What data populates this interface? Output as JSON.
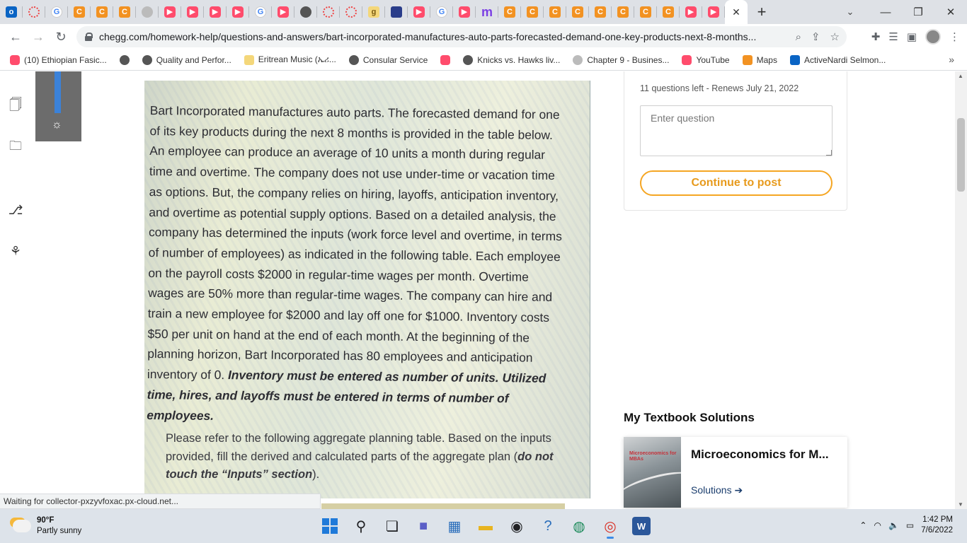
{
  "browser": {
    "url": "chegg.com/homework-help/questions-and-answers/bart-incorporated-manufactures-auto-parts-forecasted-demand-one-key-products-next-8-months...",
    "tabs": [
      {
        "icon": "outlook-icon",
        "letter": "o"
      },
      {
        "icon": "ring-icon",
        "letter": ""
      },
      {
        "icon": "google-icon",
        "letter": "G"
      },
      {
        "icon": "chegg-icon",
        "letter": "C"
      },
      {
        "icon": "chegg-icon",
        "letter": "C"
      },
      {
        "icon": "chegg-icon",
        "letter": "C"
      },
      {
        "icon": "seal-icon",
        "letter": ""
      },
      {
        "icon": "youtube-icon",
        "letter": "▶"
      },
      {
        "icon": "youtube-icon",
        "letter": "▶"
      },
      {
        "icon": "youtube-icon",
        "letter": "▶"
      },
      {
        "icon": "youtube-icon",
        "letter": "▶"
      },
      {
        "icon": "google-icon",
        "letter": "G"
      },
      {
        "icon": "youtube-icon",
        "letter": "▶"
      },
      {
        "icon": "globe-icon",
        "letter": ""
      },
      {
        "icon": "ring-icon",
        "letter": ""
      },
      {
        "icon": "ring-icon",
        "letter": ""
      },
      {
        "icon": "g-icon",
        "letter": "g"
      },
      {
        "icon": "shield-icon",
        "letter": ""
      },
      {
        "icon": "youtube-icon",
        "letter": "▶"
      },
      {
        "icon": "google-icon",
        "letter": "G"
      },
      {
        "icon": "youtube-icon",
        "letter": "▶"
      },
      {
        "icon": "m-icon",
        "letter": "m"
      },
      {
        "icon": "chegg-icon",
        "letter": "C"
      },
      {
        "icon": "chegg-icon",
        "letter": "C"
      },
      {
        "icon": "chegg-icon",
        "letter": "C"
      },
      {
        "icon": "chegg-icon",
        "letter": "C"
      },
      {
        "icon": "chegg-icon",
        "letter": "C"
      },
      {
        "icon": "chegg-icon",
        "letter": "C"
      },
      {
        "icon": "chegg-icon",
        "letter": "C"
      },
      {
        "icon": "chegg-icon",
        "letter": "C"
      },
      {
        "icon": "youtube-icon",
        "letter": "▶"
      },
      {
        "icon": "youtube-icon",
        "letter": "▶"
      }
    ],
    "bookmarks": [
      {
        "label": "(10) Ethiopian Fasic...",
        "icon": "youtube-icon"
      },
      {
        "label": "",
        "icon": "globe-icon"
      },
      {
        "label": "Quality and Perfor...",
        "icon": "globe-icon"
      },
      {
        "label": "Eritrean Music (ኤሪ...",
        "icon": "music-icon"
      },
      {
        "label": "Consular Service",
        "icon": "globe-icon"
      },
      {
        "label": "",
        "icon": "youtube-icon"
      },
      {
        "label": "Knicks vs. Hawks liv...",
        "icon": "globe-icon"
      },
      {
        "label": "Chapter 9 - Busines...",
        "icon": "grid-icon"
      },
      {
        "label": "YouTube",
        "icon": "youtube-icon"
      },
      {
        "label": "Maps",
        "icon": "maps-icon"
      },
      {
        "label": "ActiveNardi Selmon...",
        "icon": "facebook-icon"
      }
    ]
  },
  "question_image": {
    "paragraph1": "Bart Incorporated manufactures auto parts. The forecasted demand for one of its key products during the next 8 months is provided in the table below. An employee can produce an average of 10 units a month during regular time and overtime. The company does not use under-time or vacation time as options. But, the company relies on hiring, layoffs, anticipation inventory, and overtime as potential supply options. Based on a detailed analysis, the company has determined the inputs (work force level and overtime, in terms of number of employees) as indicated in the following table. Each employee on the payroll costs $2000 in regular-time wages per month. Overtime wages are 50% more than regular-time wages. The company can hire and train a new employee for $2000 and lay off one for $1000. Inventory costs $50 per unit on hand at the end of each month. At the beginning of the planning horizon, Bart Incorporated has 80 employees and anticipation inventory of 0.",
    "paragraph1_bold": "Inventory must be entered as number of units. Utilized time, hires, and layoffs must be entered in terms of number of employees.",
    "paragraph2": "Please refer to the following aggregate planning table. Based on the inputs provided, fill the derived and calculated parts of the aggregate plan (",
    "paragraph2_bold": "do not touch the “Inputs” section",
    "paragraph2_end": ")."
  },
  "sidebar": {
    "questions_left": "11 questions left - Renews July 21, 2022",
    "question_placeholder": "Enter question",
    "post_button": "Continue to post"
  },
  "textbook": {
    "heading": "My Textbook Solutions",
    "title": "Microeconomics for M...",
    "cover_text": "Microeconomics for MBAs",
    "link": "Solutions ➔"
  },
  "status": "Waiting for collector-pxzyvfoxac.px-cloud.net...",
  "taskbar": {
    "temperature": "90°F",
    "weather": "Partly sunny",
    "time": "1:42 PM",
    "date": "7/6/2022"
  }
}
